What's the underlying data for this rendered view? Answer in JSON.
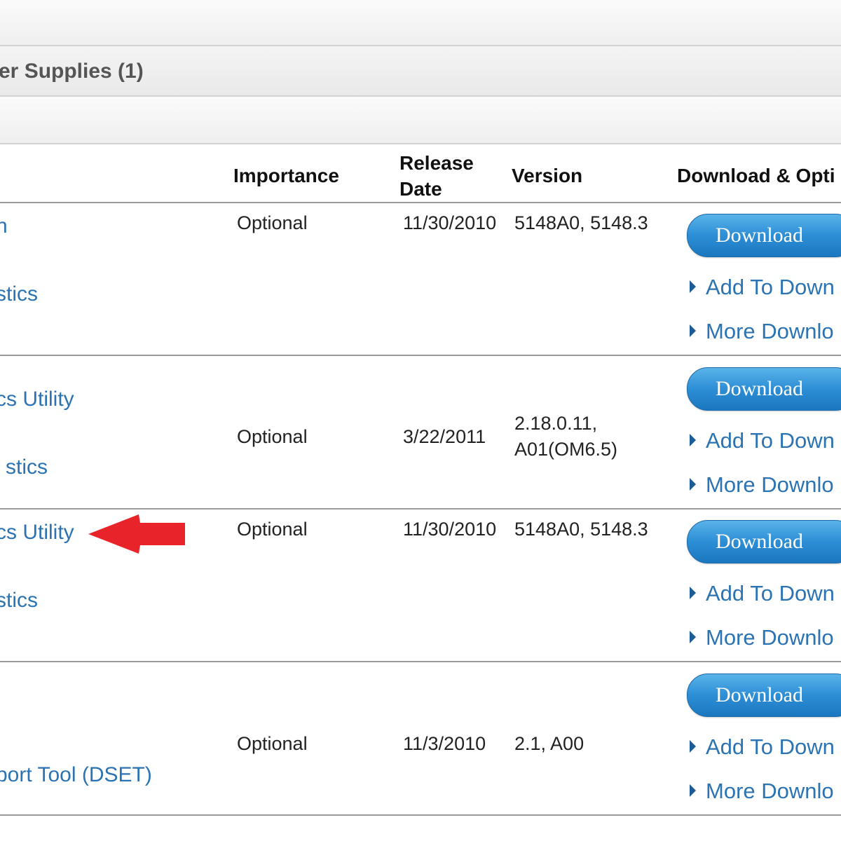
{
  "category": {
    "label": "er Supplies (1)"
  },
  "headers": {
    "importance": "Importance",
    "release_line1": "Release",
    "release_line2": "Date",
    "version": "Version",
    "download_options": "Download & Opti"
  },
  "rows": [
    {
      "link1": "n",
      "link2": "stics",
      "importance": "Optional",
      "date": "11/30/2010",
      "version_line1": "5148A0, 5148.3",
      "version_line2": "",
      "download": "Download",
      "add": "Add To Down",
      "more": "More Downlo"
    },
    {
      "link1": "cs Utility",
      "link2": "stics",
      "importance": "Optional",
      "date": "3/22/2011",
      "version_line1": "2.18.0.11,",
      "version_line2": "A01(OM6.5)",
      "download": "Download",
      "add": "Add To Down",
      "more": "More Downlo"
    },
    {
      "link1": "cs Utility",
      "link2": "stics",
      "importance": "Optional",
      "date": "11/30/2010",
      "version_line1": "5148A0, 5148.3",
      "version_line2": "",
      "download": "Download",
      "add": "Add To Down",
      "more": "More Downlo"
    },
    {
      "link1": "",
      "link2": "port Tool (DSET)",
      "importance": "Optional",
      "date": "11/3/2010",
      "version_line1": "2.1, A00",
      "version_line2": "",
      "download": "Download",
      "add": "Add To Down",
      "more": "More Downlo"
    }
  ],
  "colors": {
    "link": "#2c73b3",
    "button": "#2d8ed5",
    "arrow": "#e8232a"
  }
}
